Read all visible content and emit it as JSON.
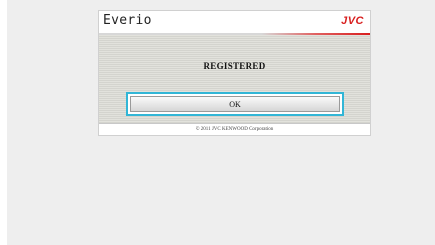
{
  "app": {
    "brand": "Everio",
    "logo_text": "JVC",
    "logo_color": "#d81e1e"
  },
  "dialog": {
    "status_text": "REGISTERED",
    "ok_label": "OK",
    "focus_color": "#32b6d6"
  },
  "footer": {
    "copyright": "© 2011 JVC KENWOOD Corporation"
  }
}
